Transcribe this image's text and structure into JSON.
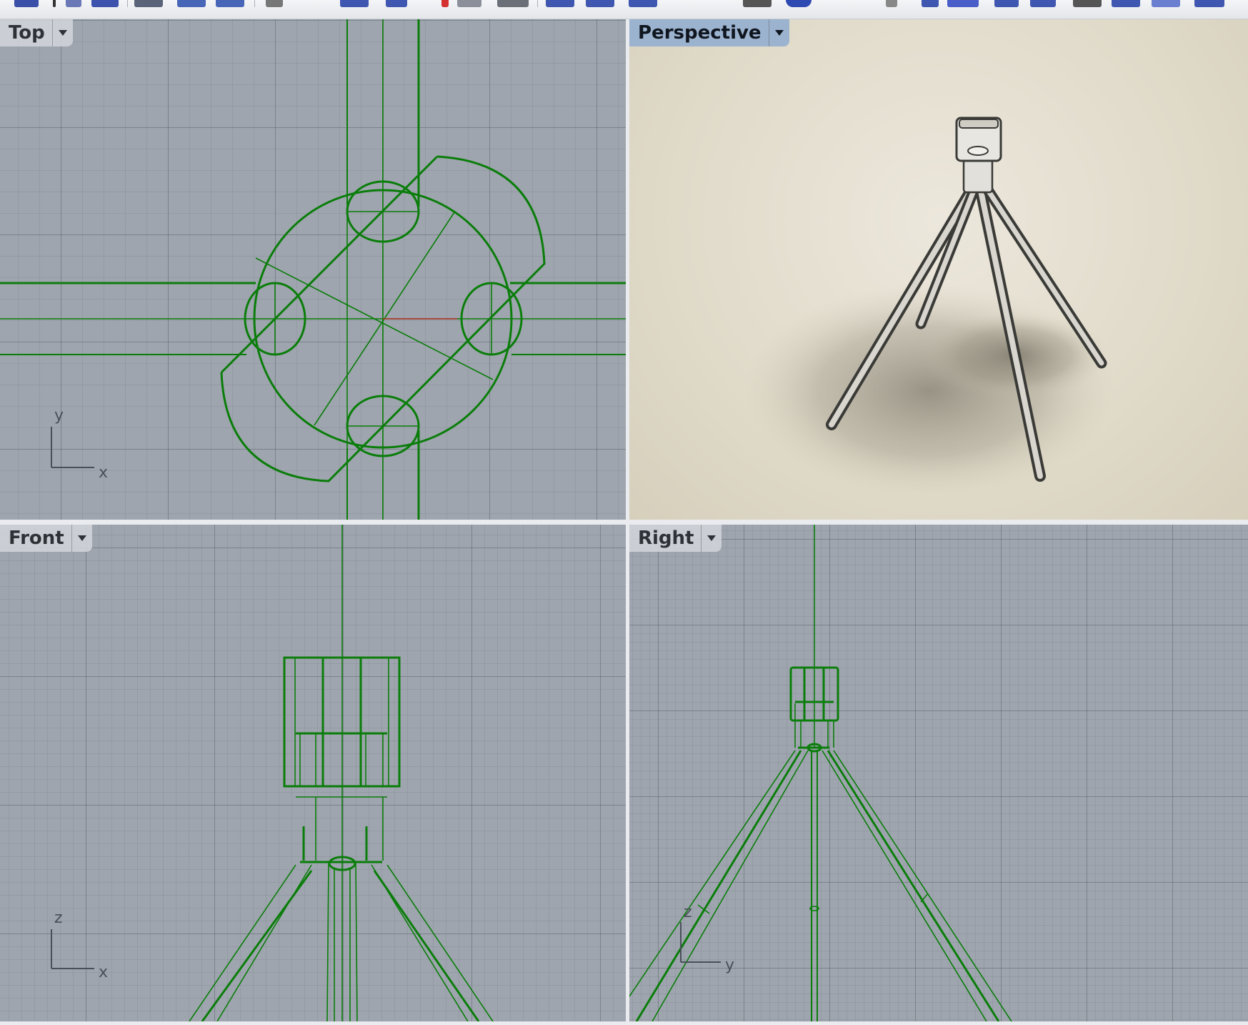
{
  "viewports": {
    "top": {
      "title": "Top",
      "axis_h": "x",
      "axis_v": "y"
    },
    "perspective": {
      "title": "Perspective"
    },
    "front": {
      "title": "Front",
      "axis_h": "x",
      "axis_v": "z"
    },
    "right": {
      "title": "Right",
      "axis_h": "y",
      "axis_v": "z"
    }
  },
  "colors": {
    "wire": "#0a7d0a",
    "viewport_bg": "#9ea5ae",
    "active_label": "#9cb3cf",
    "perspective_bg": "#e3ddcc"
  },
  "toolbar": {
    "icons": [
      "layer-icon",
      "select-icon",
      "grid-icon",
      "point-icon",
      "curve-icon",
      "arc-icon",
      "cylinder-icon",
      "surface-icon",
      "loft-icon",
      "move-icon",
      "gumball-icon",
      "dimension-icon",
      "mesh-icon",
      "sphere-icon",
      "render-icon",
      "display-icon",
      "panel-icon",
      "grid-snap-icon",
      "viewport-icon"
    ]
  }
}
